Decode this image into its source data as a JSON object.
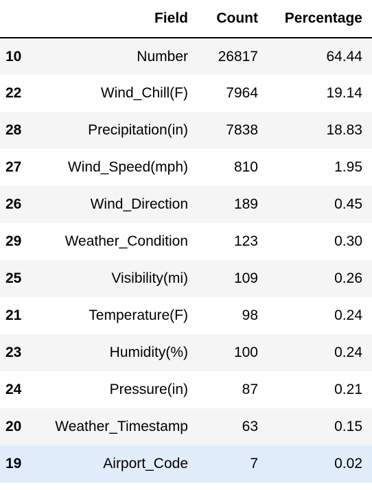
{
  "table": {
    "headers": {
      "index": "",
      "field": "Field",
      "count": "Count",
      "percentage": "Percentage"
    },
    "rows": [
      {
        "index": "10",
        "field": "Number",
        "count": "26817",
        "percentage": "64.44"
      },
      {
        "index": "22",
        "field": "Wind_Chill(F)",
        "count": "7964",
        "percentage": "19.14"
      },
      {
        "index": "28",
        "field": "Precipitation(in)",
        "count": "7838",
        "percentage": "18.83"
      },
      {
        "index": "27",
        "field": "Wind_Speed(mph)",
        "count": "810",
        "percentage": "1.95"
      },
      {
        "index": "26",
        "field": "Wind_Direction",
        "count": "189",
        "percentage": "0.45"
      },
      {
        "index": "29",
        "field": "Weather_Condition",
        "count": "123",
        "percentage": "0.30"
      },
      {
        "index": "25",
        "field": "Visibility(mi)",
        "count": "109",
        "percentage": "0.26"
      },
      {
        "index": "21",
        "field": "Temperature(F)",
        "count": "98",
        "percentage": "0.24"
      },
      {
        "index": "23",
        "field": "Humidity(%)",
        "count": "100",
        "percentage": "0.24"
      },
      {
        "index": "24",
        "field": "Pressure(in)",
        "count": "87",
        "percentage": "0.21"
      },
      {
        "index": "20",
        "field": "Weather_Timestamp",
        "count": "63",
        "percentage": "0.15"
      },
      {
        "index": "19",
        "field": "Airport_Code",
        "count": "7",
        "percentage": "0.02"
      }
    ]
  },
  "colors": {
    "row_stripe": "#f5f5f5",
    "row_hover": "#e1ecfa",
    "header_rule": "#000000"
  }
}
